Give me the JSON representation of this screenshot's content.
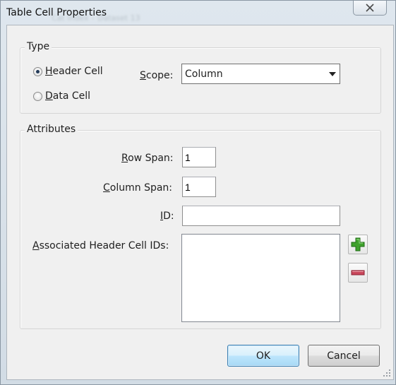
{
  "window": {
    "title": "Table Cell Properties",
    "background_title": "Cat Index – Dataset 13"
  },
  "type_group": {
    "label": "Type",
    "header_cell": {
      "label_prefix": "",
      "accel": "H",
      "label_rest": "eader Cell",
      "checked": true
    },
    "data_cell": {
      "label_prefix": "",
      "accel": "D",
      "label_rest": "ata Cell",
      "checked": false
    },
    "scope": {
      "accel": "S",
      "label_rest": "cope:",
      "value": "Column"
    }
  },
  "attributes_group": {
    "label": "Attributes",
    "row_span": {
      "accel": "R",
      "label_rest": "ow Span:",
      "value": "1"
    },
    "column_span": {
      "accel": "C",
      "label_rest": "olumn Span:",
      "value": "1"
    },
    "id": {
      "accel": "I",
      "label_rest": "D:",
      "value": ""
    },
    "associated_ids": {
      "accel": "A",
      "label_rest": "ssociated Header Cell IDs:"
    }
  },
  "buttons": {
    "ok": "OK",
    "cancel": "Cancel"
  },
  "icons": {
    "close": "close-icon",
    "add": "plus-icon",
    "remove": "minus-icon",
    "dropdown": "chevron-down-icon"
  },
  "colors": {
    "add_green": "#3fa12c",
    "remove_red": "#c8465a",
    "default_button_border": "#3c7fb1"
  }
}
